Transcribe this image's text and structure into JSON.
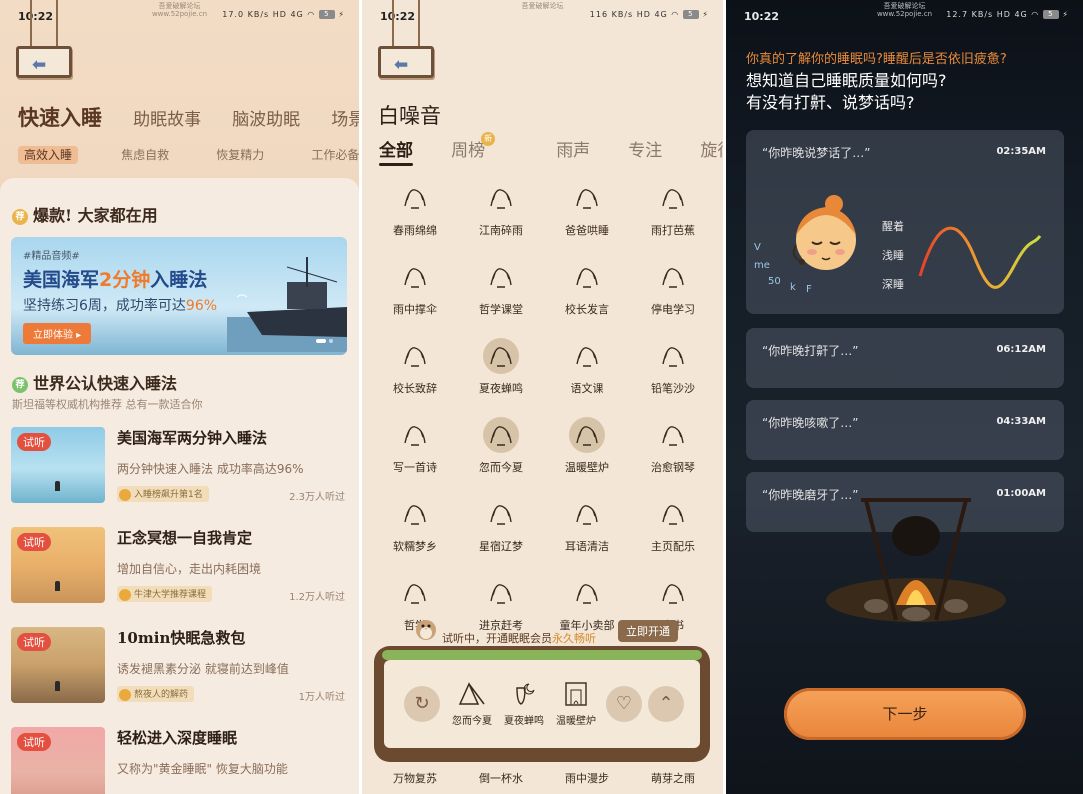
{
  "panel1": {
    "status": {
      "time": "10:22",
      "icons": "17.0 KB/s HD 4G",
      "battery": "5",
      "watermark": "吾爱破解论坛\nwww.52pojie.cn"
    },
    "tabs": [
      "快速入睡",
      "助眠故事",
      "脑波助眠",
      "场景"
    ],
    "subtabs": [
      "高效入睡",
      "焦虑自救",
      "恢复精力",
      "工作必备"
    ],
    "hot_title": "爆款! 大家都在用",
    "hot_badge": "荐",
    "banner": {
      "tag": "#精品音频#",
      "title_a": "美国海军",
      "title_b": "2分钟",
      "title_c": "入睡法",
      "line_a": "坚持练习6周，成功率可达",
      "line_b": "96%",
      "button": "立即体验 ▸"
    },
    "section_title": "世界公认快速入睡法",
    "section_badge": "荐",
    "section_sub": "斯坦福等权威机构推荐 总有一款适合你",
    "try_label": "试听",
    "items": [
      {
        "title": "美国海军两分钟入睡法",
        "desc": "两分钟快速入睡法 成功率高达96%",
        "rank": "入睡榜飙升第1名",
        "count": "2.3万人听过"
      },
      {
        "title": "正念冥想一自我肯定",
        "desc": "增加自信心，走出内耗困境",
        "rank": "牛津大学推荐课程",
        "count": "1.2万人听过"
      },
      {
        "title": "10min快眠急救包",
        "desc": "诱发褪黑素分泌 就寝前达到峰值",
        "rank": "熬夜人的解药",
        "count": "1万人听过"
      },
      {
        "title": "轻松进入深度睡眠",
        "desc": "又称为\"黄金睡眠\" 恢复大脑功能",
        "rank": "",
        "count": ""
      }
    ]
  },
  "panel2": {
    "status": {
      "time": "10:22",
      "icons": "116 KB/s HD 4G",
      "battery": "5",
      "watermark": "吾爱破解论坛"
    },
    "title": "白噪音",
    "tabs": [
      "全部",
      "周榜",
      "雨声",
      "专注",
      "旋律"
    ],
    "new_badge": "新",
    "grid": [
      "春雨绵绵",
      "江南碎雨",
      "爸爸哄睡",
      "雨打芭蕉",
      "雨中撑伞",
      "哲学课堂",
      "校长发言",
      "停电学习",
      "校长致辞",
      "夏夜蝉鸣",
      "语文课",
      "铅笔沙沙",
      "写一首诗",
      "忽而今夏",
      "温暖壁炉",
      "治愈钢琴",
      "软糯梦乡",
      "星宿辽梦",
      "耳语清洁",
      "主页配乐",
      "哲学",
      "进京赶考",
      "童年小卖部",
      "本书"
    ],
    "trial_text_a": "试听中，开通眠眠会员",
    "trial_text_b": "永久畅听",
    "open_button": "立即开通",
    "player_items": [
      "忽而今夏",
      "夏夜蝉鸣",
      "温暖壁炉"
    ],
    "bottom_row": [
      "万物复苏",
      "倒一杯水",
      "雨中漫步",
      "萌芽之雨"
    ]
  },
  "panel3": {
    "status": {
      "time": "10:22",
      "icons": "12.7 KB/s HD 4G",
      "battery": "5",
      "watermark": "吾爱破解论坛\nwww.52pojie.cn"
    },
    "q_orange": "你真的了解你的睡眠吗?睡醒后是否依旧疲惫?",
    "q_white_1": "想知道自己睡眠质量如何吗?",
    "q_white_2": "有没有打鼾、说梦话吗?",
    "legend": [
      "醒着",
      "浅睡",
      "深睡"
    ],
    "face_letters": [
      "V",
      "me",
      "50",
      "k",
      "F"
    ],
    "talks": [
      {
        "q": "“你昨晚说梦话了…”",
        "t": "02:35AM"
      },
      {
        "q": "“你昨晚打鼾了…”",
        "t": "06:12AM"
      },
      {
        "q": "“你昨晚咳嗽了…”",
        "t": "04:33AM"
      },
      {
        "q": "“你昨晚磨牙了…”",
        "t": "01:00AM"
      }
    ],
    "next_button": "下一步"
  }
}
